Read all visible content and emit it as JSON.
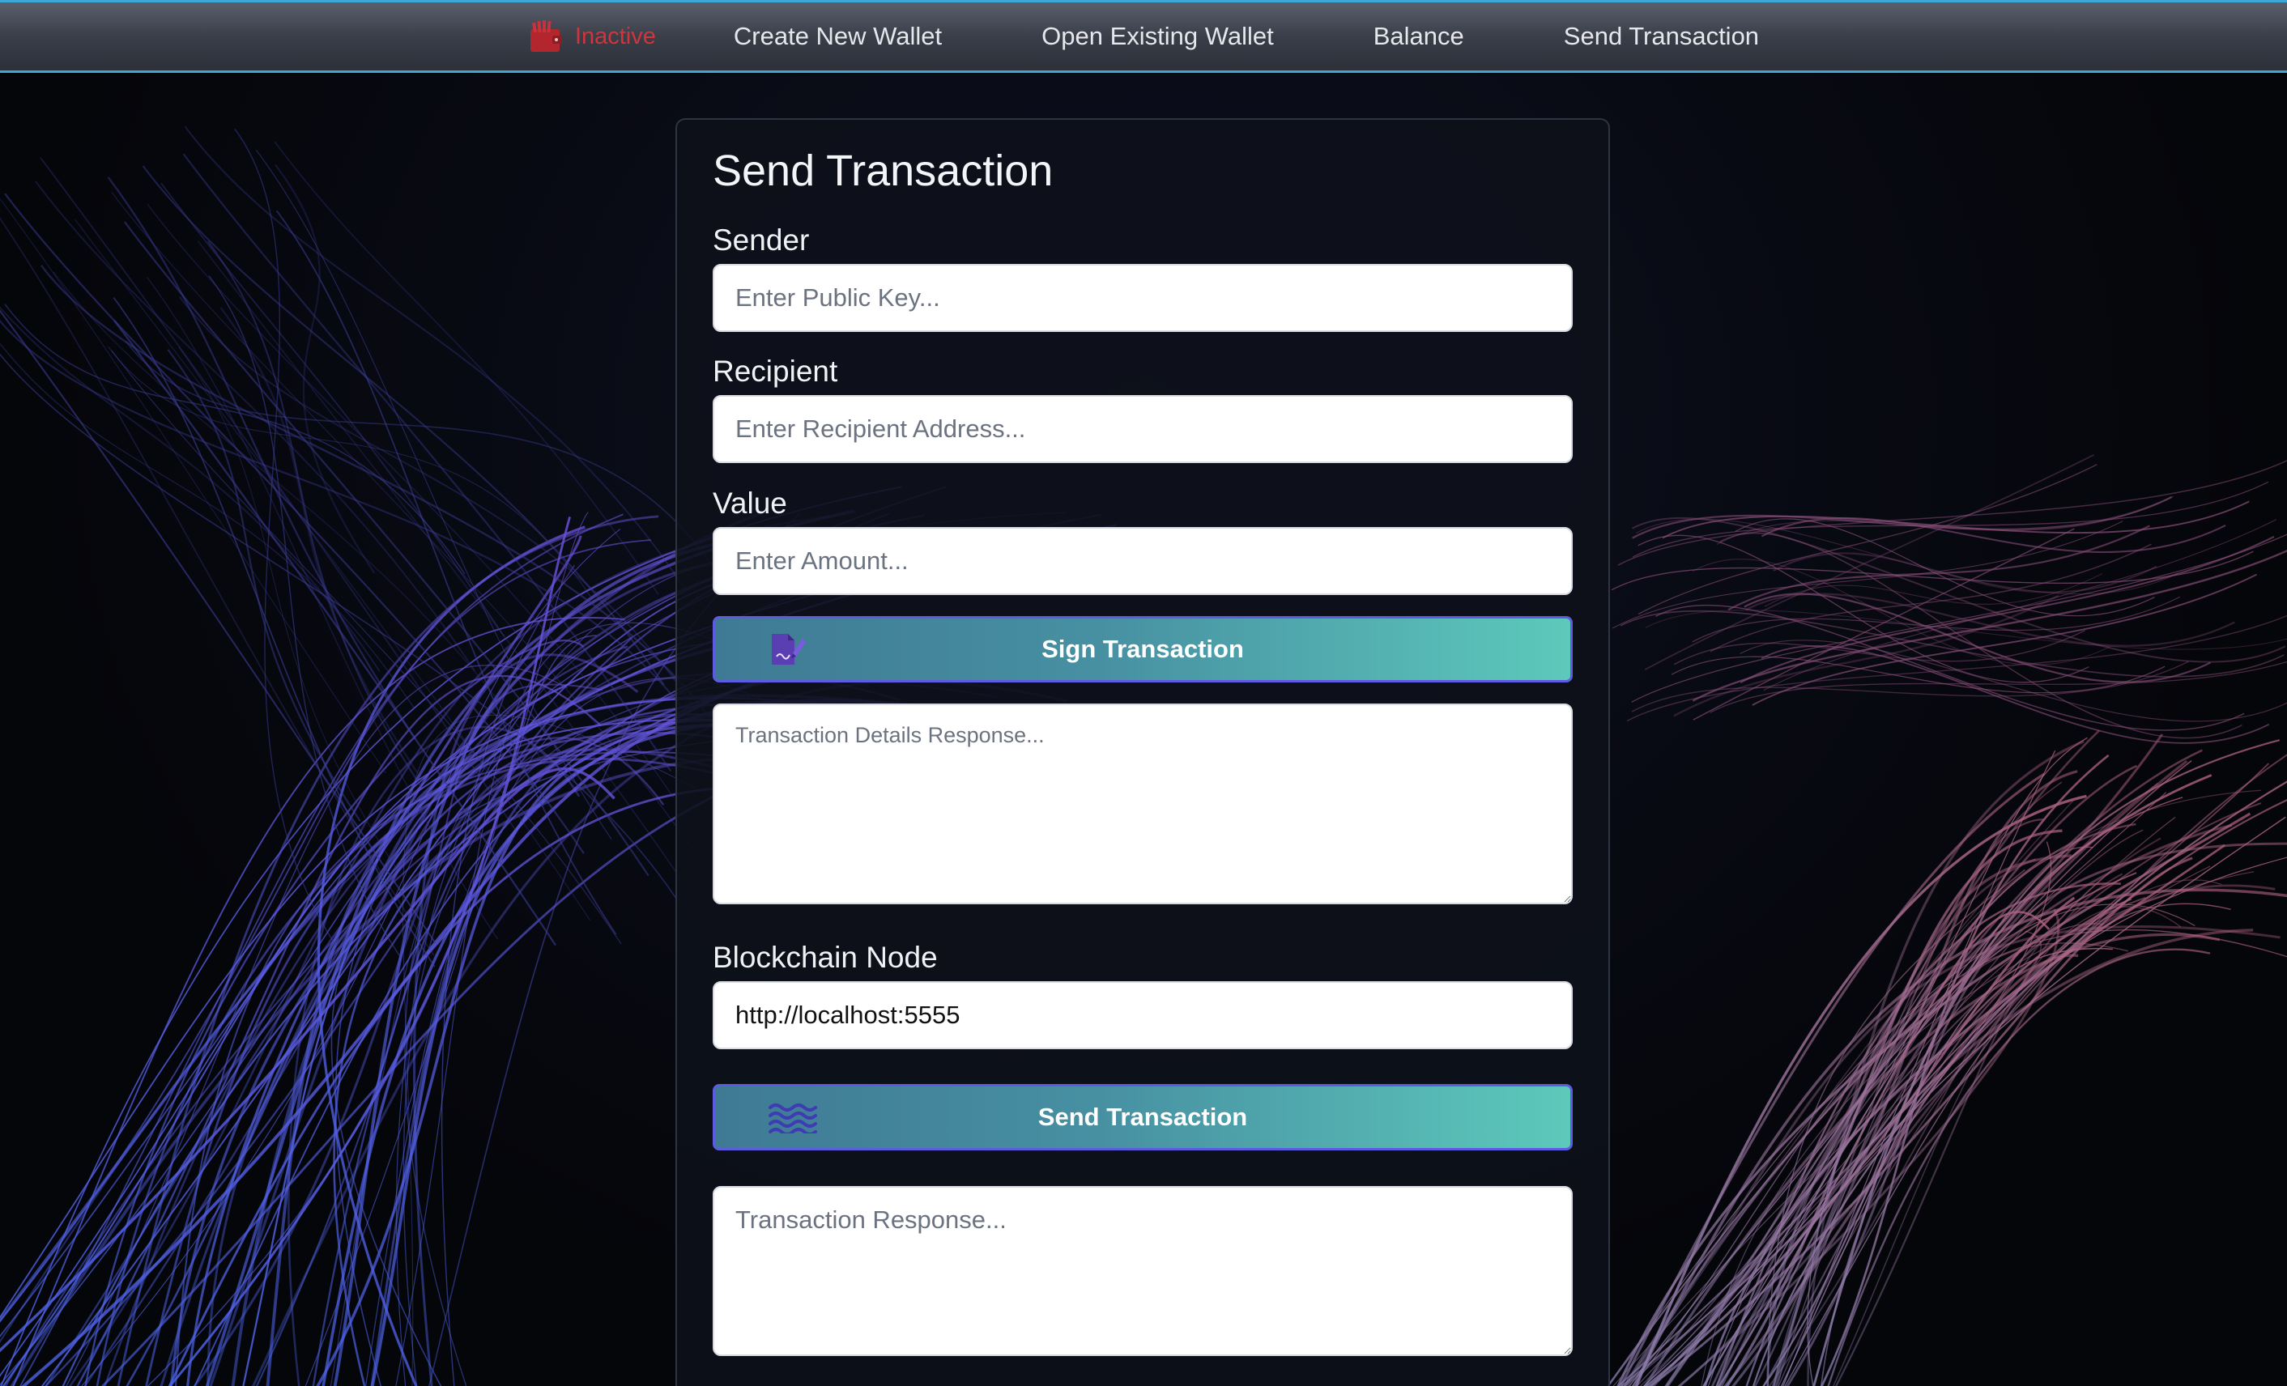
{
  "nav": {
    "status": "Inactive",
    "links": [
      "Create New Wallet",
      "Open Existing Wallet",
      "Balance",
      "Send Transaction"
    ]
  },
  "colors": {
    "accent_border": "#3fa7d6",
    "status_inactive": "#d2343a",
    "button_gradient_start": "#3f7a94",
    "button_gradient_end": "#5dc9bb",
    "button_border": "#5d5be0"
  },
  "icons": {
    "nav_status": "wallet-icon",
    "sign_button": "signature-icon",
    "send_button": "waves-icon"
  },
  "form": {
    "title": "Send Transaction",
    "sender": {
      "label": "Sender",
      "placeholder": "Enter Public Key...",
      "value": ""
    },
    "recipient": {
      "label": "Recipient",
      "placeholder": "Enter Recipient Address...",
      "value": ""
    },
    "amount": {
      "label": "Value",
      "placeholder": "Enter Amount...",
      "value": ""
    },
    "sign_button_label": "Sign Transaction",
    "details_response_placeholder": "Transaction Details Response...",
    "node": {
      "label": "Blockchain Node",
      "value": "http://localhost:5555"
    },
    "send_button_label": "Send Transaction",
    "response_placeholder": "Transaction Response..."
  }
}
